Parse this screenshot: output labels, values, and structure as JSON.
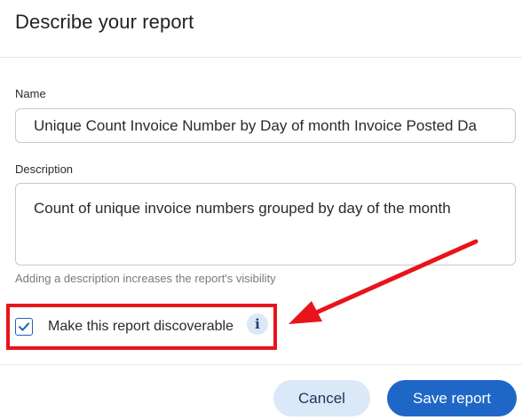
{
  "dialog": {
    "title": "Describe your report",
    "name_label": "Name",
    "name_value": "Unique Count Invoice Number by Day of month Invoice Posted Da",
    "description_label": "Description",
    "description_value": "Count of unique invoice numbers grouped by day of the month",
    "helper_text": "Adding a description increases the report's visibility",
    "discoverable_label": "Make this report discoverable",
    "discoverable_checked": true,
    "info_glyph": "i",
    "cancel_label": "Cancel",
    "save_label": "Save report"
  },
  "colors": {
    "primary": "#1f67c7",
    "secondary_bg": "#dbe8f8",
    "annotation": "#e8141b"
  },
  "icons": {
    "checkbox": "check-icon",
    "info": "info-icon",
    "annotation_arrow": "arrow-icon"
  }
}
